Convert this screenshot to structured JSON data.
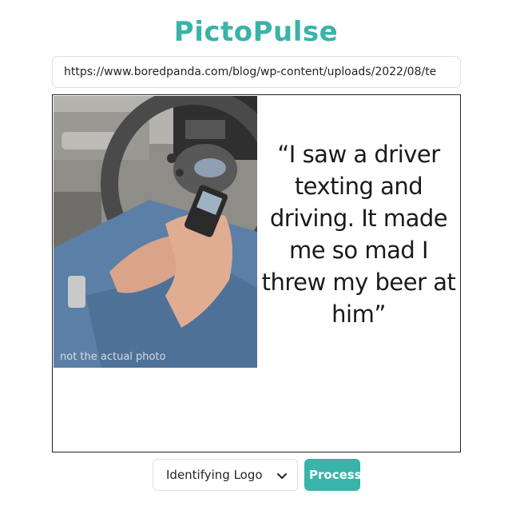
{
  "app": {
    "title": "PictoPulse"
  },
  "url_field": {
    "value": "https://www.boredpanda.com/blog/wp-content/uploads/2022/08/te"
  },
  "image": {
    "quote": "“I saw a driver texting and driving. It made me so mad I threw my beer at him”",
    "watermark": "not the actual photo"
  },
  "controls": {
    "mode_select": {
      "selected": "Identifying Logo"
    },
    "process_label": "Process"
  },
  "colors": {
    "accent": "#3ab3a8"
  }
}
